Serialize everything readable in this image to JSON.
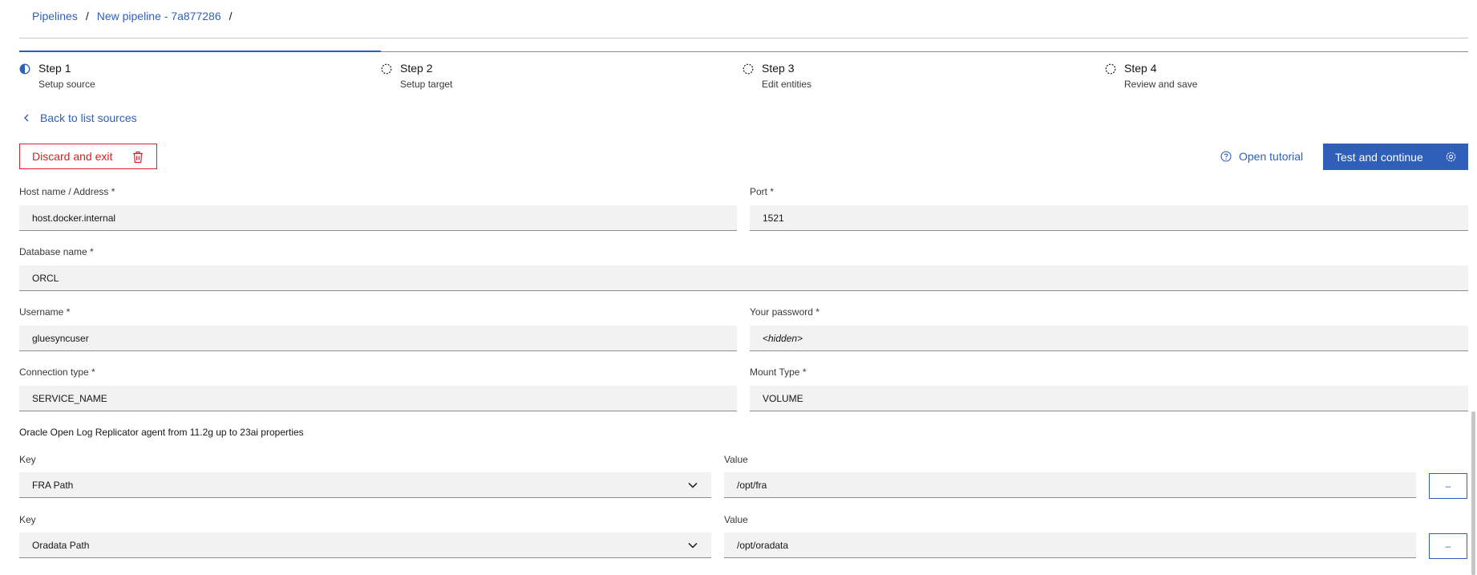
{
  "breadcrumb": {
    "items": [
      "Pipelines",
      "New pipeline - 7a877286"
    ],
    "separator": "/"
  },
  "progress": {
    "steps": [
      {
        "label": "Step 1",
        "sublabel": "Setup source",
        "state": "current"
      },
      {
        "label": "Step 2",
        "sublabel": "Setup target",
        "state": "incomplete"
      },
      {
        "label": "Step 3",
        "sublabel": "Edit entities",
        "state": "incomplete"
      },
      {
        "label": "Step 4",
        "sublabel": "Review and save",
        "state": "incomplete"
      }
    ]
  },
  "nav": {
    "back_label": "Back to list sources"
  },
  "toolbar": {
    "discard_label": "Discard and exit",
    "tutorial_label": "Open tutorial",
    "primary_label": "Test and continue"
  },
  "form": {
    "host": {
      "label": "Host name / Address *",
      "value": "host.docker.internal"
    },
    "port": {
      "label": "Port *",
      "value": "1521"
    },
    "database": {
      "label": "Database name *",
      "value": "ORCL"
    },
    "username": {
      "label": "Username *",
      "value": "gluesyncuser"
    },
    "password": {
      "label": "Your password *",
      "value": "<hidden>"
    },
    "connection_type": {
      "label": "Connection type *",
      "value": "SERVICE_NAME"
    },
    "mount_type": {
      "label": "Mount Type *",
      "value": "VOLUME"
    }
  },
  "properties": {
    "title": "Oracle Open Log Replicator agent from 11.2g up to 23ai  properties",
    "key_label": "Key",
    "value_label": "Value",
    "remove_label": "–",
    "rows": [
      {
        "key": "FRA Path",
        "value": "/opt/fra"
      },
      {
        "key": "Oradata Path",
        "value": "/opt/oradata"
      }
    ]
  },
  "colors": {
    "accent": "#2f5fb8",
    "danger": "#da1e28",
    "field_bg": "#f2f2f2"
  },
  "icons": {
    "step_current": "half-circle-icon",
    "step_incomplete": "dashed-circle-icon",
    "back": "chevron-left-icon",
    "discard": "trash-icon",
    "tutorial": "help-icon",
    "primary": "gear-icon",
    "dropdown": "chevron-down-icon"
  }
}
